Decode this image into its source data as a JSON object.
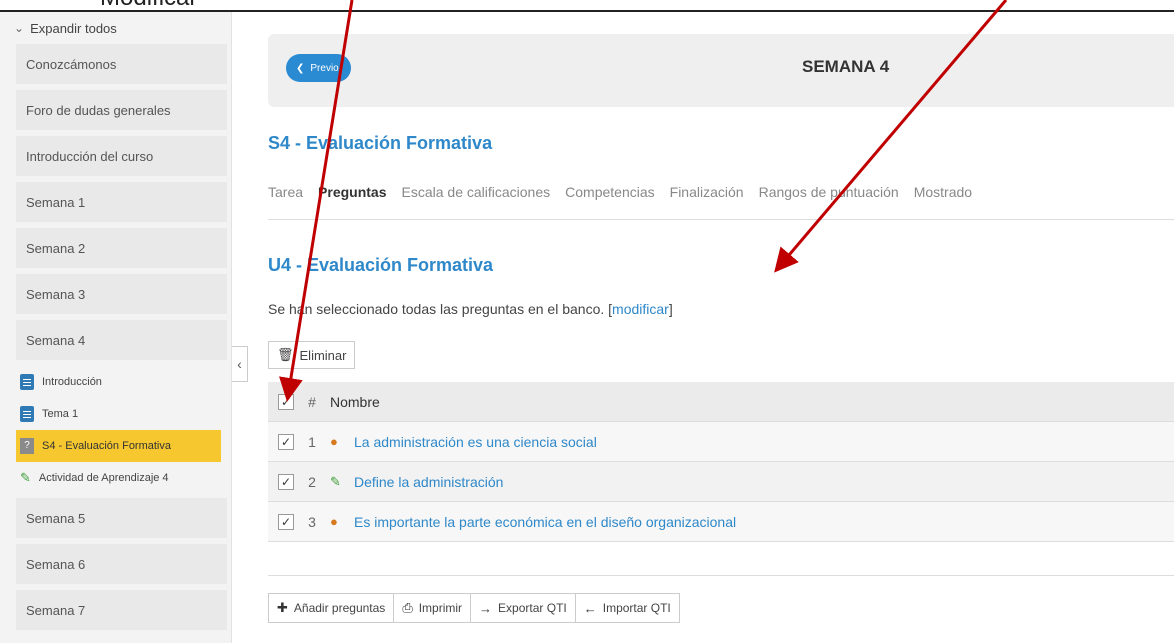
{
  "top_label": "Modificar",
  "sidebar": {
    "expand_label": "Expandir todos",
    "items_top": [
      {
        "label": "Conozcámonos"
      },
      {
        "label": "Foro de dudas generales"
      },
      {
        "label": "Introducción del curso"
      },
      {
        "label": "Semana 1"
      },
      {
        "label": "Semana 2"
      },
      {
        "label": "Semana 3"
      },
      {
        "label": "Semana 4"
      }
    ],
    "sub_items": [
      {
        "label": "Introducción",
        "icon": "document-icon"
      },
      {
        "label": "Tema 1",
        "icon": "document-icon"
      },
      {
        "label": "S4 - Evaluación Formativa",
        "icon": "quiz-icon",
        "active": true
      },
      {
        "label": "Actividad de Aprendizaje 4",
        "icon": "pencil-icon"
      }
    ],
    "items_bottom": [
      {
        "label": "Semana 5"
      },
      {
        "label": "Semana 6"
      },
      {
        "label": "Semana 7"
      }
    ]
  },
  "header": {
    "prev_label": "Previo",
    "week_title": "SEMANA 4"
  },
  "activity_title": "S4 - Evaluación Formativa",
  "tabs": [
    {
      "label": "Tarea"
    },
    {
      "label": "Preguntas",
      "active": true
    },
    {
      "label": "Escala de calificaciones"
    },
    {
      "label": "Competencias"
    },
    {
      "label": "Finalización"
    },
    {
      "label": "Rangos de puntuación"
    },
    {
      "label": "Mostrado"
    }
  ],
  "bank": {
    "title": "U4 - Evaluación Formativa",
    "info_text": "Se han seleccionado todas las preguntas en el banco.",
    "modify_open": "[",
    "modify_link": "modificar",
    "modify_close": "]"
  },
  "delete_label": "Eliminar",
  "table": {
    "col_num": "#",
    "col_name": "Nombre",
    "rows": [
      {
        "num": "1",
        "name": "La administración es una ciencia social",
        "type": "multiple-choice-icon",
        "checked": true
      },
      {
        "num": "2",
        "name": "Define la administración",
        "type": "essay-pencil-icon",
        "checked": true
      },
      {
        "num": "3",
        "name": "Es importante la parte económica en el diseño organizacional",
        "type": "multiple-choice-icon",
        "checked": true
      }
    ]
  },
  "bottom_toolbar": {
    "add_label": "Añadir preguntas",
    "print_label": "Imprimir",
    "export_label": "Exportar QTI",
    "import_label": "Importar QTI"
  },
  "colors": {
    "accent": "#2e88c9",
    "active_item": "#f6c72e",
    "annotation_arrow": "#c00000"
  }
}
